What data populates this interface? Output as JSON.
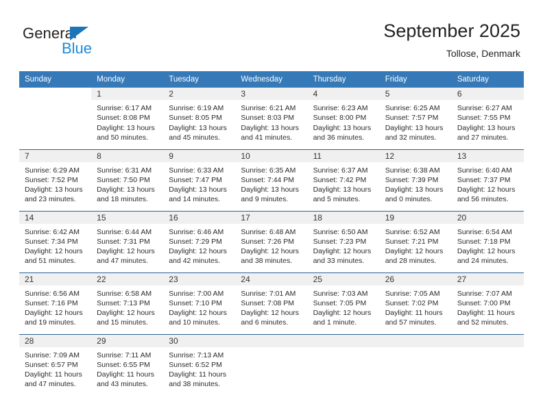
{
  "brand": {
    "name_part1": "General",
    "name_part2": "Blue",
    "triangle_color": "#1b75bb",
    "blue_color": "#1b8ada"
  },
  "header": {
    "title": "September 2025",
    "subtitle": "Tollose, Denmark"
  },
  "theme": {
    "header_row_bg": "#3579b8",
    "week_separator": "#2a6496",
    "daynum_band_bg": "#f0f0f0"
  },
  "weekdays": [
    "Sunday",
    "Monday",
    "Tuesday",
    "Wednesday",
    "Thursday",
    "Friday",
    "Saturday"
  ],
  "weeks": [
    [
      {
        "day": "",
        "blank": true,
        "sunrise": "",
        "sunset": "",
        "daylight1": "",
        "daylight2": ""
      },
      {
        "day": "1",
        "sunrise": "Sunrise: 6:17 AM",
        "sunset": "Sunset: 8:08 PM",
        "daylight1": "Daylight: 13 hours",
        "daylight2": "and 50 minutes."
      },
      {
        "day": "2",
        "sunrise": "Sunrise: 6:19 AM",
        "sunset": "Sunset: 8:05 PM",
        "daylight1": "Daylight: 13 hours",
        "daylight2": "and 45 minutes."
      },
      {
        "day": "3",
        "sunrise": "Sunrise: 6:21 AM",
        "sunset": "Sunset: 8:03 PM",
        "daylight1": "Daylight: 13 hours",
        "daylight2": "and 41 minutes."
      },
      {
        "day": "4",
        "sunrise": "Sunrise: 6:23 AM",
        "sunset": "Sunset: 8:00 PM",
        "daylight1": "Daylight: 13 hours",
        "daylight2": "and 36 minutes."
      },
      {
        "day": "5",
        "sunrise": "Sunrise: 6:25 AM",
        "sunset": "Sunset: 7:57 PM",
        "daylight1": "Daylight: 13 hours",
        "daylight2": "and 32 minutes."
      },
      {
        "day": "6",
        "sunrise": "Sunrise: 6:27 AM",
        "sunset": "Sunset: 7:55 PM",
        "daylight1": "Daylight: 13 hours",
        "daylight2": "and 27 minutes."
      }
    ],
    [
      {
        "day": "7",
        "sunrise": "Sunrise: 6:29 AM",
        "sunset": "Sunset: 7:52 PM",
        "daylight1": "Daylight: 13 hours",
        "daylight2": "and 23 minutes."
      },
      {
        "day": "8",
        "sunrise": "Sunrise: 6:31 AM",
        "sunset": "Sunset: 7:50 PM",
        "daylight1": "Daylight: 13 hours",
        "daylight2": "and 18 minutes."
      },
      {
        "day": "9",
        "sunrise": "Sunrise: 6:33 AM",
        "sunset": "Sunset: 7:47 PM",
        "daylight1": "Daylight: 13 hours",
        "daylight2": "and 14 minutes."
      },
      {
        "day": "10",
        "sunrise": "Sunrise: 6:35 AM",
        "sunset": "Sunset: 7:44 PM",
        "daylight1": "Daylight: 13 hours",
        "daylight2": "and 9 minutes."
      },
      {
        "day": "11",
        "sunrise": "Sunrise: 6:37 AM",
        "sunset": "Sunset: 7:42 PM",
        "daylight1": "Daylight: 13 hours",
        "daylight2": "and 5 minutes."
      },
      {
        "day": "12",
        "sunrise": "Sunrise: 6:38 AM",
        "sunset": "Sunset: 7:39 PM",
        "daylight1": "Daylight: 13 hours",
        "daylight2": "and 0 minutes."
      },
      {
        "day": "13",
        "sunrise": "Sunrise: 6:40 AM",
        "sunset": "Sunset: 7:37 PM",
        "daylight1": "Daylight: 12 hours",
        "daylight2": "and 56 minutes."
      }
    ],
    [
      {
        "day": "14",
        "sunrise": "Sunrise: 6:42 AM",
        "sunset": "Sunset: 7:34 PM",
        "daylight1": "Daylight: 12 hours",
        "daylight2": "and 51 minutes."
      },
      {
        "day": "15",
        "sunrise": "Sunrise: 6:44 AM",
        "sunset": "Sunset: 7:31 PM",
        "daylight1": "Daylight: 12 hours",
        "daylight2": "and 47 minutes."
      },
      {
        "day": "16",
        "sunrise": "Sunrise: 6:46 AM",
        "sunset": "Sunset: 7:29 PM",
        "daylight1": "Daylight: 12 hours",
        "daylight2": "and 42 minutes."
      },
      {
        "day": "17",
        "sunrise": "Sunrise: 6:48 AM",
        "sunset": "Sunset: 7:26 PM",
        "daylight1": "Daylight: 12 hours",
        "daylight2": "and 38 minutes."
      },
      {
        "day": "18",
        "sunrise": "Sunrise: 6:50 AM",
        "sunset": "Sunset: 7:23 PM",
        "daylight1": "Daylight: 12 hours",
        "daylight2": "and 33 minutes."
      },
      {
        "day": "19",
        "sunrise": "Sunrise: 6:52 AM",
        "sunset": "Sunset: 7:21 PM",
        "daylight1": "Daylight: 12 hours",
        "daylight2": "and 28 minutes."
      },
      {
        "day": "20",
        "sunrise": "Sunrise: 6:54 AM",
        "sunset": "Sunset: 7:18 PM",
        "daylight1": "Daylight: 12 hours",
        "daylight2": "and 24 minutes."
      }
    ],
    [
      {
        "day": "21",
        "sunrise": "Sunrise: 6:56 AM",
        "sunset": "Sunset: 7:16 PM",
        "daylight1": "Daylight: 12 hours",
        "daylight2": "and 19 minutes."
      },
      {
        "day": "22",
        "sunrise": "Sunrise: 6:58 AM",
        "sunset": "Sunset: 7:13 PM",
        "daylight1": "Daylight: 12 hours",
        "daylight2": "and 15 minutes."
      },
      {
        "day": "23",
        "sunrise": "Sunrise: 7:00 AM",
        "sunset": "Sunset: 7:10 PM",
        "daylight1": "Daylight: 12 hours",
        "daylight2": "and 10 minutes."
      },
      {
        "day": "24",
        "sunrise": "Sunrise: 7:01 AM",
        "sunset": "Sunset: 7:08 PM",
        "daylight1": "Daylight: 12 hours",
        "daylight2": "and 6 minutes."
      },
      {
        "day": "25",
        "sunrise": "Sunrise: 7:03 AM",
        "sunset": "Sunset: 7:05 PM",
        "daylight1": "Daylight: 12 hours",
        "daylight2": "and 1 minute."
      },
      {
        "day": "26",
        "sunrise": "Sunrise: 7:05 AM",
        "sunset": "Sunset: 7:02 PM",
        "daylight1": "Daylight: 11 hours",
        "daylight2": "and 57 minutes."
      },
      {
        "day": "27",
        "sunrise": "Sunrise: 7:07 AM",
        "sunset": "Sunset: 7:00 PM",
        "daylight1": "Daylight: 11 hours",
        "daylight2": "and 52 minutes."
      }
    ],
    [
      {
        "day": "28",
        "sunrise": "Sunrise: 7:09 AM",
        "sunset": "Sunset: 6:57 PM",
        "daylight1": "Daylight: 11 hours",
        "daylight2": "and 47 minutes."
      },
      {
        "day": "29",
        "sunrise": "Sunrise: 7:11 AM",
        "sunset": "Sunset: 6:55 PM",
        "daylight1": "Daylight: 11 hours",
        "daylight2": "and 43 minutes."
      },
      {
        "day": "30",
        "sunrise": "Sunrise: 7:13 AM",
        "sunset": "Sunset: 6:52 PM",
        "daylight1": "Daylight: 11 hours",
        "daylight2": "and 38 minutes."
      },
      {
        "day": "",
        "empty": true,
        "sunrise": "",
        "sunset": "",
        "daylight1": "",
        "daylight2": ""
      },
      {
        "day": "",
        "empty": true,
        "sunrise": "",
        "sunset": "",
        "daylight1": "",
        "daylight2": ""
      },
      {
        "day": "",
        "empty": true,
        "sunrise": "",
        "sunset": "",
        "daylight1": "",
        "daylight2": ""
      },
      {
        "day": "",
        "empty": true,
        "sunrise": "",
        "sunset": "",
        "daylight1": "",
        "daylight2": ""
      }
    ]
  ]
}
